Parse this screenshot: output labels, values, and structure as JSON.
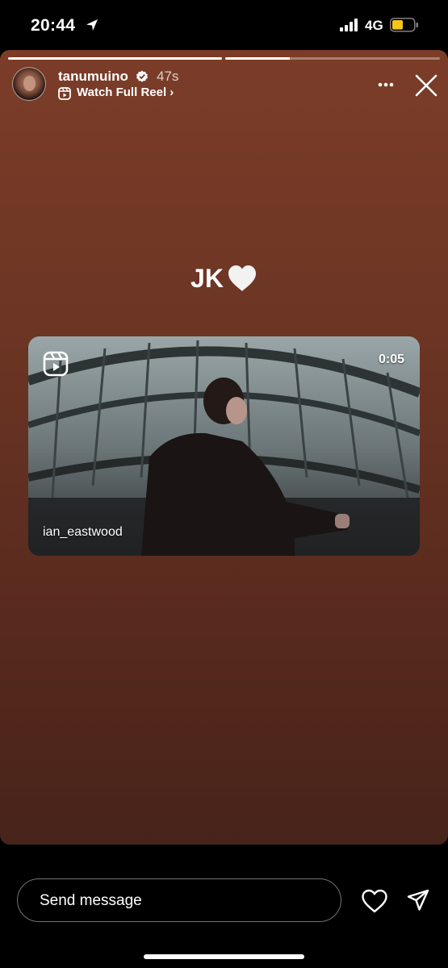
{
  "status_bar": {
    "time": "20:44",
    "network": "4G",
    "battery_color": "#f5c518"
  },
  "story": {
    "progress": [
      1.0,
      0.3
    ],
    "username": "tanumuino",
    "time_ago": "47s",
    "watch_label": "Watch Full Reel",
    "watch_chevron": "›",
    "caption": "JK",
    "reel": {
      "duration": "0:05",
      "author": "ian_eastwood"
    }
  },
  "bottom_bar": {
    "message_placeholder": "Send message"
  },
  "colors": {
    "story_bg_top": "#7b3d28",
    "story_bg_bottom": "#47231a"
  }
}
